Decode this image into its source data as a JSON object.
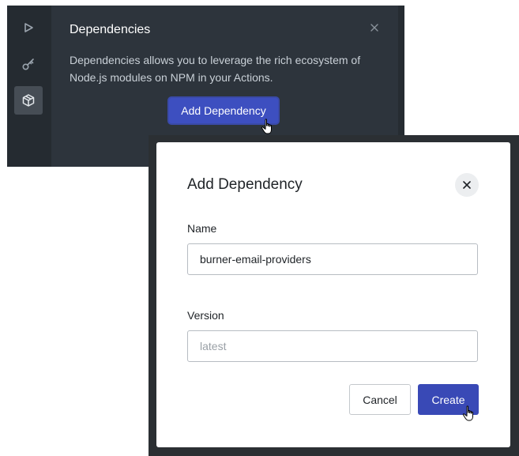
{
  "panel": {
    "title": "Dependencies",
    "description": "Dependencies allows you to leverage the rich ecosystem of Node.js modules on NPM in your Actions.",
    "add_button_label": "Add Dependency",
    "rail_icons": [
      "play-icon",
      "key-icon",
      "package-icon"
    ],
    "active_rail_icon": "package-icon"
  },
  "modal": {
    "title": "Add Dependency",
    "name_label": "Name",
    "name_value": "burner-email-providers",
    "version_label": "Version",
    "version_placeholder": "latest",
    "cancel_label": "Cancel",
    "create_label": "Create"
  },
  "colors": {
    "panel_bg": "#2d343c",
    "primary": "#3949b6",
    "modal_frame": "#2b2f33"
  }
}
